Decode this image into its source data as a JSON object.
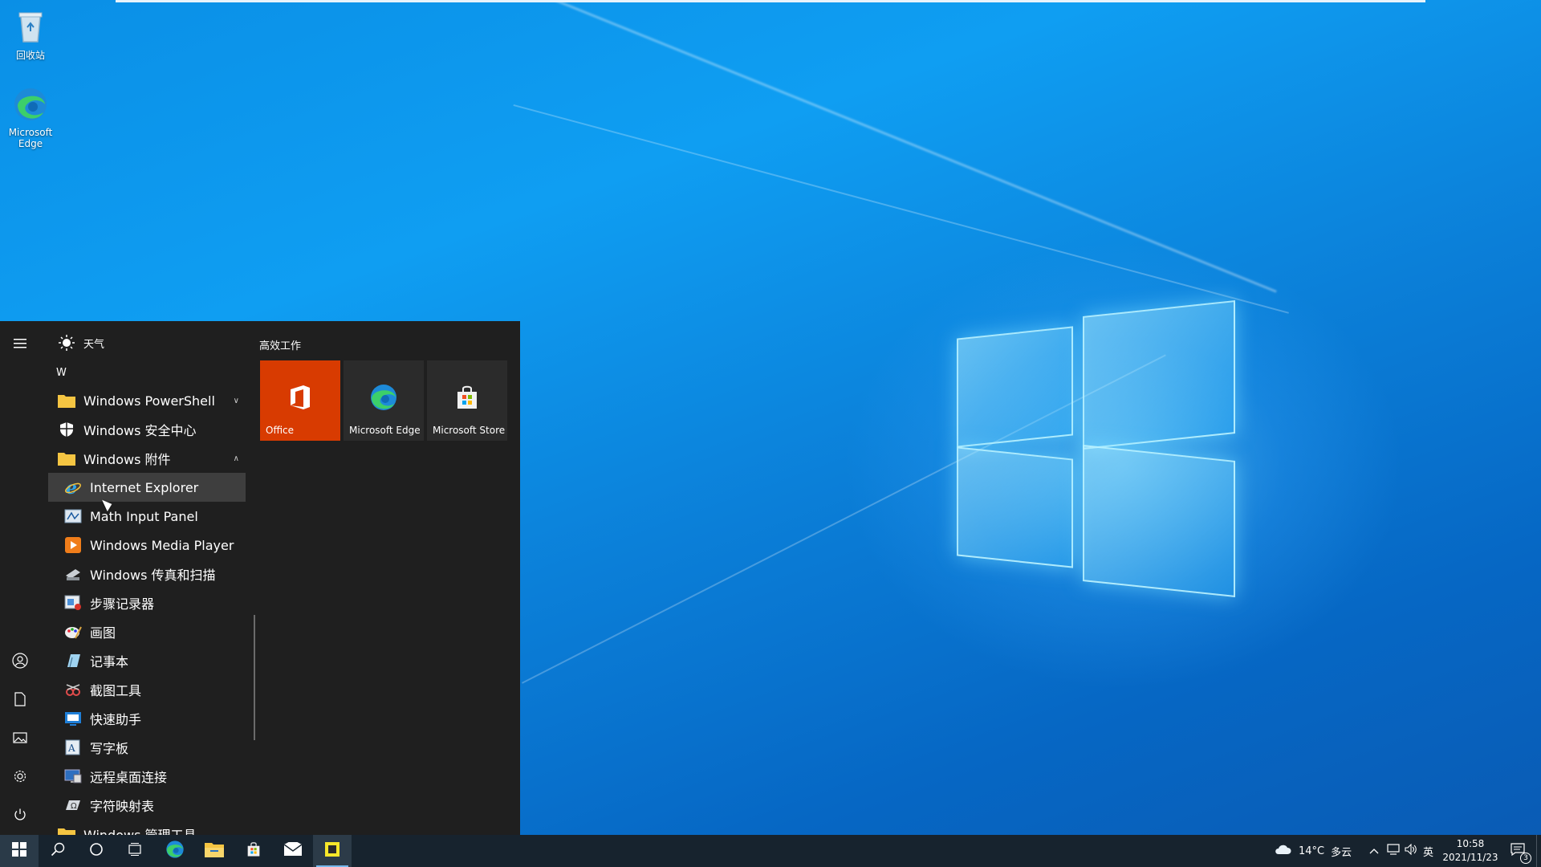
{
  "desktop": {
    "icons": [
      {
        "label": "回收站",
        "icon": "recycle-bin-icon"
      },
      {
        "label": "Microsoft Edge",
        "icon": "edge-icon"
      }
    ]
  },
  "start_menu": {
    "top_item": {
      "label": "天气",
      "icon": "sun-icon"
    },
    "letter": "W",
    "items": [
      {
        "label": "Windows PowerShell",
        "icon": "folder-icon",
        "expand": "∨"
      },
      {
        "label": "Windows 安全中心",
        "icon": "shield-icon"
      },
      {
        "label": "Windows 附件",
        "icon": "folder-icon",
        "expand": "∧"
      },
      {
        "label": "Internet Explorer",
        "icon": "internet-explorer-icon"
      },
      {
        "label": "Math Input Panel",
        "icon": "math-input-icon"
      },
      {
        "label": "Windows Media Player",
        "icon": "media-player-icon"
      },
      {
        "label": "Windows 传真和扫描",
        "icon": "fax-scan-icon"
      },
      {
        "label": "步骤记录器",
        "icon": "steps-recorder-icon"
      },
      {
        "label": "画图",
        "icon": "paint-icon"
      },
      {
        "label": "记事本",
        "icon": "notepad-icon"
      },
      {
        "label": "截图工具",
        "icon": "snipping-tool-icon"
      },
      {
        "label": "快速助手",
        "icon": "quick-assist-icon"
      },
      {
        "label": "写字板",
        "icon": "wordpad-icon"
      },
      {
        "label": "远程桌面连接",
        "icon": "remote-desktop-icon"
      },
      {
        "label": "字符映射表",
        "icon": "charmap-icon"
      },
      {
        "label": "Windows 管理工具",
        "icon": "folder-icon"
      }
    ],
    "tiles_group_title": "高效工作",
    "tiles": [
      {
        "label": "Office",
        "color": "#d83b01",
        "icon": "office-icon"
      },
      {
        "label": "Microsoft Edge",
        "color": "#2b2b2b",
        "icon": "edge-icon"
      },
      {
        "label": "Microsoft Store",
        "color": "#2b2b2b",
        "icon": "store-icon"
      }
    ]
  },
  "taskbar": {
    "weather": {
      "temp": "14°C",
      "condition": "多云"
    },
    "ime": "英",
    "time": "10:58",
    "date": "2021/11/23",
    "notifications": "3",
    "accent": "#76b9ed"
  }
}
